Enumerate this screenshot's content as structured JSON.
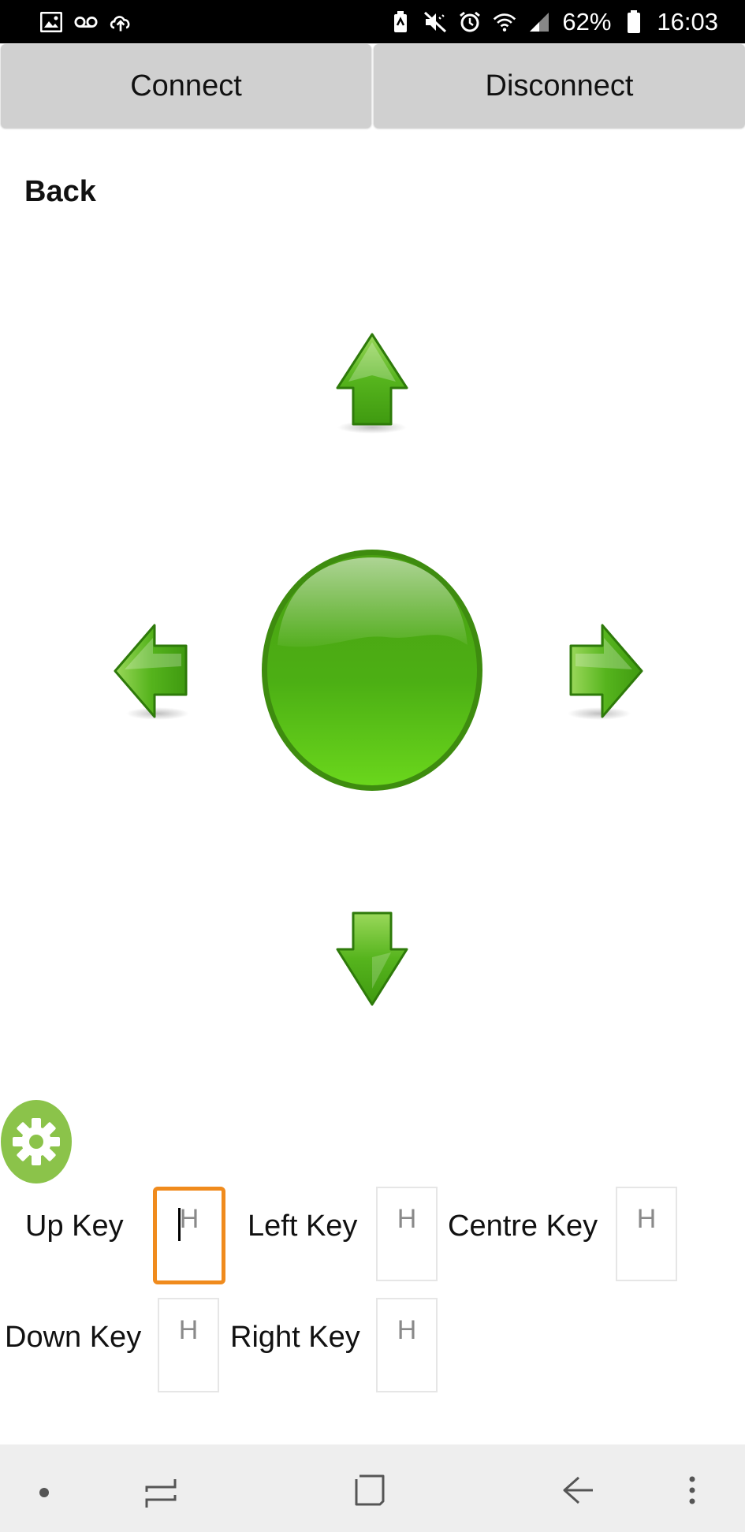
{
  "status_bar": {
    "battery_percent": "62%",
    "time": "16:03",
    "left_icons": [
      "gallery-icon",
      "voicemail-icon",
      "cloud-upload-icon"
    ],
    "right_icons": [
      "battery-saver-icon",
      "mute-icon",
      "alarm-icon",
      "wifi-icon",
      "signal-icon",
      "battery-icon"
    ]
  },
  "toolbar": {
    "connect_label": "Connect",
    "disconnect_label": "Disconnect"
  },
  "back_label": "Back",
  "dpad": {
    "up": "arrow-up-icon",
    "down": "arrow-down-icon",
    "left": "arrow-left-icon",
    "right": "arrow-right-icon",
    "centre": "centre-button",
    "color": "#4caf1a"
  },
  "settings": {
    "icon": "gear-icon",
    "color": "#8bc34a"
  },
  "key_config": {
    "up": {
      "label": "Up Key",
      "placeholder": "H"
    },
    "left": {
      "label": "Left Key",
      "placeholder": "H"
    },
    "centre": {
      "label": "Centre Key",
      "placeholder": "H"
    },
    "down": {
      "label": "Down Key",
      "placeholder": "H"
    },
    "right": {
      "label": "Right Key",
      "placeholder": "H"
    },
    "focus_color": "#f08b1d"
  },
  "nav_bar": {
    "icons": [
      "dot-icon",
      "recent-apps-icon",
      "home-icon",
      "back-icon",
      "more-icon"
    ]
  }
}
